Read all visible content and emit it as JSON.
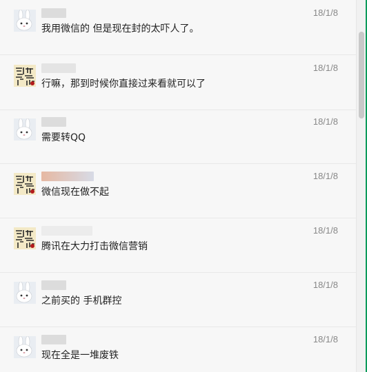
{
  "messages": [
    {
      "avatar": "rabbit-avatar",
      "time": "18/1/8",
      "text": "我用微信的  但是现在封的太吓人了。"
    },
    {
      "avatar": "calligraphy-avatar",
      "time": "18/1/8",
      "text": "行嘛，那到时候你直接过来看就可以了"
    },
    {
      "avatar": "rabbit-avatar",
      "time": "18/1/8",
      "text": "需要转QQ"
    },
    {
      "avatar": "calligraphy-avatar",
      "time": "18/1/8",
      "text": "微信现在做不起"
    },
    {
      "avatar": "calligraphy-avatar",
      "time": "18/1/8",
      "text": "腾讯在大力打击微信营销"
    },
    {
      "avatar": "rabbit-avatar",
      "time": "18/1/8",
      "text": "之前买的 手机群控"
    },
    {
      "avatar": "rabbit-avatar",
      "time": "18/1/8",
      "text": "现在全是一堆废铁"
    }
  ],
  "colors": {
    "time": "#888888",
    "text": "#222222",
    "divider": "#e8e8e8",
    "background": "#f7f7f7"
  }
}
